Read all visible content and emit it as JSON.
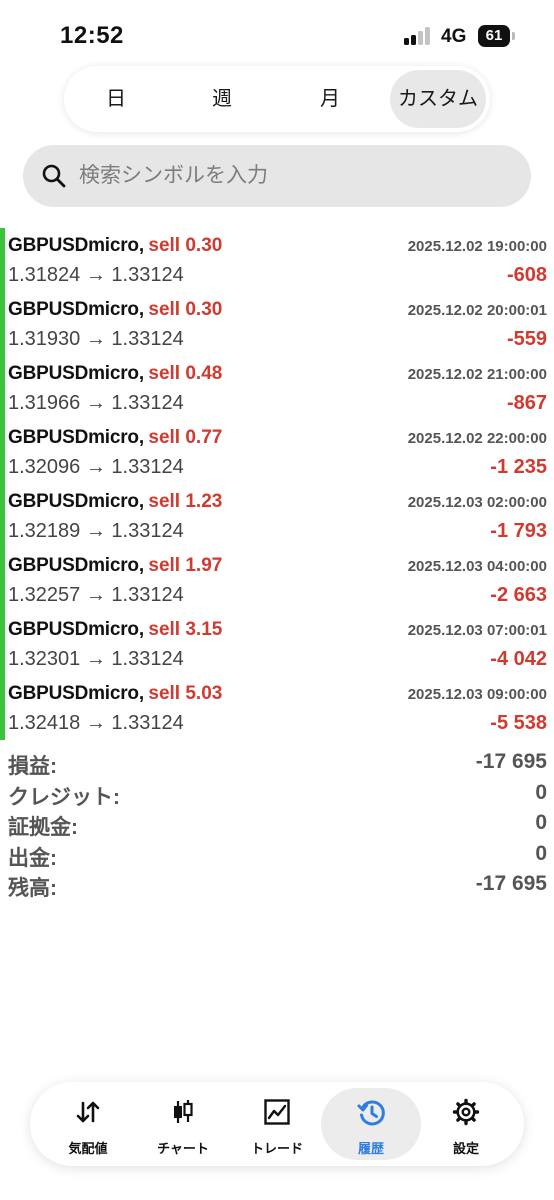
{
  "status_bar": {
    "time": "12:52",
    "network": "4G",
    "battery": "61"
  },
  "period_tabs": [
    {
      "label": "日"
    },
    {
      "label": "週"
    },
    {
      "label": "月"
    },
    {
      "label": "カスタム",
      "selected": true
    }
  ],
  "search": {
    "placeholder": "検索シンボルを入力",
    "value": ""
  },
  "trades": [
    {
      "symbol": "GBPUSDmicro,",
      "action": "sell 0.30",
      "datetime": "2025.12.02 19:00:00",
      "prices": "1.31824 → 1.33124",
      "profit": "-608"
    },
    {
      "symbol": "GBPUSDmicro,",
      "action": "sell 0.30",
      "datetime": "2025.12.02 20:00:01",
      "prices": "1.31930 → 1.33124",
      "profit": "-559"
    },
    {
      "symbol": "GBPUSDmicro,",
      "action": "sell 0.48",
      "datetime": "2025.12.02 21:00:00",
      "prices": "1.31966 → 1.33124",
      "profit": "-867"
    },
    {
      "symbol": "GBPUSDmicro,",
      "action": "sell 0.77",
      "datetime": "2025.12.02 22:00:00",
      "prices": "1.32096 → 1.33124",
      "profit": "-1 235"
    },
    {
      "symbol": "GBPUSDmicro,",
      "action": "sell 1.23",
      "datetime": "2025.12.03 02:00:00",
      "prices": "1.32189 → 1.33124",
      "profit": "-1 793"
    },
    {
      "symbol": "GBPUSDmicro,",
      "action": "sell 1.97",
      "datetime": "2025.12.03 04:00:00",
      "prices": "1.32257 → 1.33124",
      "profit": "-2 663"
    },
    {
      "symbol": "GBPUSDmicro,",
      "action": "sell 3.15",
      "datetime": "2025.12.03 07:00:01",
      "prices": "1.32301 → 1.33124",
      "profit": "-4 042"
    },
    {
      "symbol": "GBPUSDmicro,",
      "action": "sell 5.03",
      "datetime": "2025.12.03 09:00:00",
      "prices": "1.32418 → 1.33124",
      "profit": "-5 538"
    }
  ],
  "summary": {
    "profit": {
      "label": "損益:",
      "value": "-17 695"
    },
    "credit": {
      "label": "クレジット:",
      "value": "0"
    },
    "margin": {
      "label": "証拠金:",
      "value": "0"
    },
    "withdrawal": {
      "label": "出金:",
      "value": "0"
    },
    "balance": {
      "label": "残高:",
      "value": "-17 695"
    }
  },
  "bottom_nav": [
    {
      "label": "気配値",
      "icon": "quotes-arrows-icon"
    },
    {
      "label": "チャート",
      "icon": "candlestick-chart-icon"
    },
    {
      "label": "トレード",
      "icon": "trade-line-chart-icon"
    },
    {
      "label": "履歴",
      "icon": "history-clock-icon",
      "selected": true
    },
    {
      "label": "設定",
      "icon": "gear-icon"
    }
  ],
  "colors": {
    "loss_red": "#d03a2f",
    "trade_bar_green": "#3cc23c",
    "active_blue": "#2f7de1",
    "search_bg": "#e6e6e6"
  }
}
